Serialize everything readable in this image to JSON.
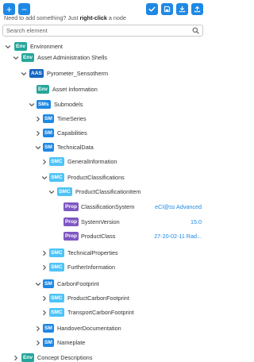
{
  "toolbar": {
    "add_label": "+",
    "remove_label": "−"
  },
  "hint": {
    "prefix": "Need to add something? Just",
    "action": "right-click",
    "suffix": "a node"
  },
  "search": {
    "placeholder": "Search element",
    "value": ""
  },
  "colors": {
    "primary": "#1e88e5",
    "env": "#26a69a",
    "aas": "#1565c0",
    "sm": "#1e88e5",
    "smc": "#4fc3f7",
    "prop": "#7e57c2",
    "value_text": "#1e88e5"
  },
  "tree": [
    {
      "id": "env",
      "chevron": "down",
      "badge": "Env",
      "badge_type": "env",
      "label": "Environment",
      "value": ""
    },
    {
      "id": "aas-shells",
      "chevron": "down",
      "badge": "Env",
      "badge_type": "env",
      "label": "Asset Administration Shells",
      "value": ""
    },
    {
      "id": "aas-pyrometer",
      "chevron": "down",
      "badge": "AAS",
      "badge_type": "aas",
      "label": "Pyrometer_Sensotherm",
      "value": ""
    },
    {
      "id": "asset-info",
      "chevron": "none",
      "badge": "Env",
      "badge_type": "env",
      "label": "Asset Information",
      "value": ""
    },
    {
      "id": "submodels",
      "chevron": "down",
      "badge": "SMs",
      "badge_type": "sm",
      "label": "Submodels",
      "value": ""
    },
    {
      "id": "timeseries",
      "chevron": "right",
      "badge": "SM",
      "badge_type": "sm",
      "label": "TimeSeries",
      "value": ""
    },
    {
      "id": "capabilities",
      "chevron": "right",
      "badge": "SM",
      "badge_type": "sm",
      "label": "Capabilities",
      "value": ""
    },
    {
      "id": "technicaldata",
      "chevron": "down",
      "badge": "SM",
      "badge_type": "sm",
      "label": "TechnicalData",
      "value": ""
    },
    {
      "id": "generalinfo",
      "chevron": "right",
      "badge": "SMC",
      "badge_type": "smc",
      "label": "GeneralInformation",
      "value": ""
    },
    {
      "id": "productclassifications",
      "chevron": "down",
      "badge": "SMC",
      "badge_type": "smc",
      "label": "ProductClassifications",
      "value": ""
    },
    {
      "id": "productclassificationitem",
      "chevron": "down",
      "badge": "SMC",
      "badge_type": "smc",
      "label": "ProductClassificationItem",
      "value": ""
    },
    {
      "id": "classificationsystem",
      "chevron": "none",
      "badge": "Prop",
      "badge_type": "prop",
      "label": "ClassificationSystem",
      "value": "eCl@ss Advanced"
    },
    {
      "id": "systemversion",
      "chevron": "none",
      "badge": "Prop",
      "badge_type": "prop",
      "label": "SystemVersion",
      "value": "15.0"
    },
    {
      "id": "productclass",
      "chevron": "none",
      "badge": "Prop",
      "badge_type": "prop",
      "label": "ProductClass",
      "value": "27-20-02-11 Rad..."
    },
    {
      "id": "technicalproperties",
      "chevron": "right",
      "badge": "SMC",
      "badge_type": "smc",
      "label": "TechnicalProperties",
      "value": ""
    },
    {
      "id": "furtherinformation",
      "chevron": "right",
      "badge": "SMC",
      "badge_type": "smc",
      "label": "FurtherInformation",
      "value": ""
    },
    {
      "id": "carbonfootprint",
      "chevron": "down",
      "badge": "SM",
      "badge_type": "sm",
      "label": "CarbonFootprint",
      "value": ""
    },
    {
      "id": "productcarbon",
      "chevron": "right",
      "badge": "SMC",
      "badge_type": "smc",
      "label": "ProductCarbonFootprint",
      "value": ""
    },
    {
      "id": "transportcarbon",
      "chevron": "right",
      "badge": "SMC",
      "badge_type": "smc",
      "label": "TransportCarbonFootprint",
      "value": ""
    },
    {
      "id": "handover",
      "chevron": "right",
      "badge": "SM",
      "badge_type": "sm",
      "label": "HandoverDocumentation",
      "value": ""
    },
    {
      "id": "nameplate",
      "chevron": "right",
      "badge": "SM",
      "badge_type": "sm",
      "label": "Nameplate",
      "value": ""
    },
    {
      "id": "concepts",
      "chevron": "right",
      "badge": "Env",
      "badge_type": "env",
      "label": "Concept Descriptions",
      "value": ""
    }
  ]
}
